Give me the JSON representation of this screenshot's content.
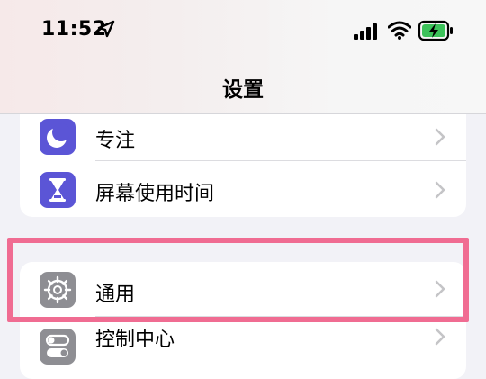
{
  "status_bar": {
    "time": "11:52"
  },
  "nav": {
    "title": "设置"
  },
  "settings": {
    "group1": [
      {
        "label": "专注",
        "icon": "moon-icon",
        "color": "#5b55d6"
      },
      {
        "label": "屏幕使用时间",
        "icon": "hourglass-icon",
        "color": "#5b55d6"
      }
    ],
    "group2": [
      {
        "label": "通用",
        "icon": "gear-icon",
        "color": "#8e8e93"
      },
      {
        "label": "控制中心",
        "icon": "toggles-icon",
        "color": "#8e8e93"
      }
    ]
  },
  "highlight_color": "#f06c92"
}
